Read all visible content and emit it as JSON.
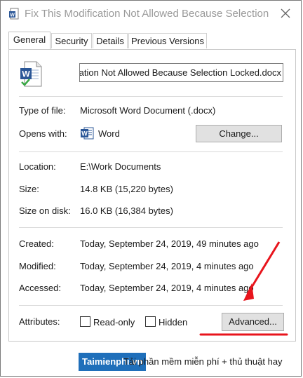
{
  "window": {
    "title": "Fix This Modification Not Allowed Because Selection Lo..."
  },
  "tabs": [
    {
      "label": "General"
    },
    {
      "label": "Security"
    },
    {
      "label": "Details"
    },
    {
      "label": "Previous Versions"
    }
  ],
  "file": {
    "name": "cation Not Allowed Because Selection Locked.docx"
  },
  "props": {
    "type_label": "Type of file:",
    "type_value": "Microsoft Word Document (.docx)",
    "opens_label": "Opens with:",
    "opens_value": "Word",
    "change_label": "Change...",
    "location_label": "Location:",
    "location_value": "E:\\Work Documents",
    "size_label": "Size:",
    "size_value": "14.8 KB (15,220 bytes)",
    "sizedisk_label": "Size on disk:",
    "sizedisk_value": "16.0 KB (16,384 bytes)",
    "created_label": "Created:",
    "created_value": "Today, September 24, 2019, 49 minutes ago",
    "modified_label": "Modified:",
    "modified_value": "Today, September 24, 2019, 4 minutes ago",
    "accessed_label": "Accessed:",
    "accessed_value": "Today, September 24, 2019, 4 minutes ago",
    "attributes_label": "Attributes:",
    "readonly_label": "Read-only",
    "hidden_label": "Hidden",
    "advanced_label": "Advanced..."
  },
  "watermark": {
    "brand": "Taimienphi.vn",
    "tagline": "Tải phần mềm miễn phí + thủ thuật hay"
  },
  "colors": {
    "annotation_red": "#e8141c",
    "brand_blue": "#1f6fba"
  }
}
